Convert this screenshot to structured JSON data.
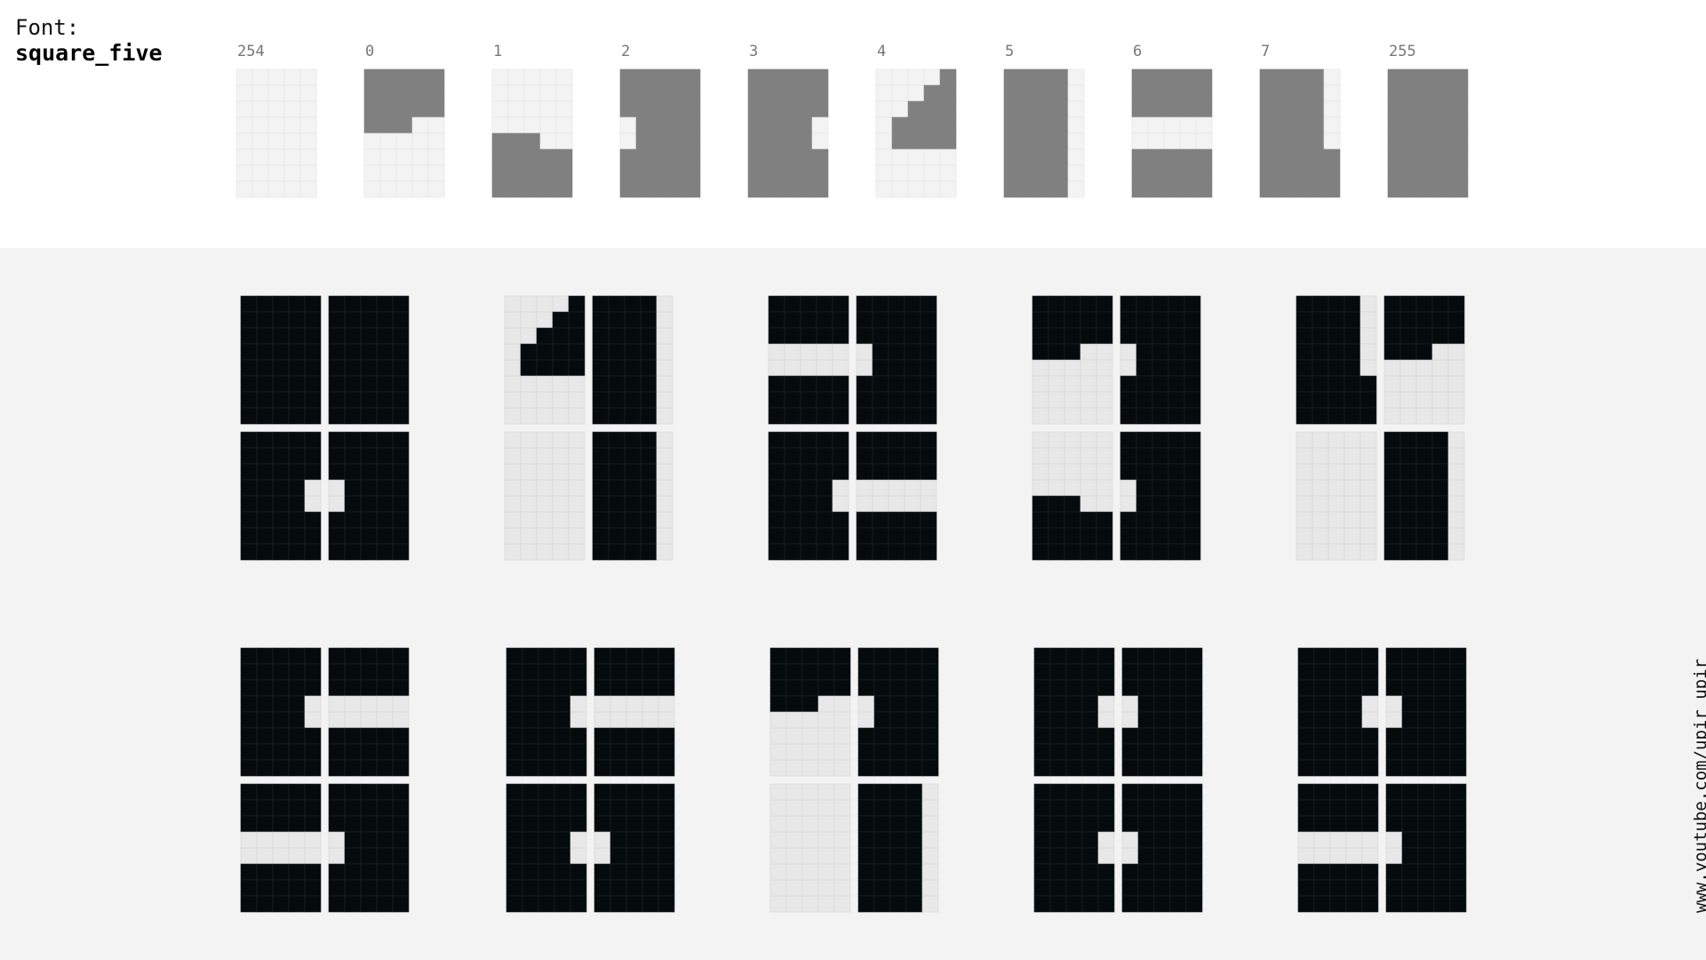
{
  "title": {
    "label": "Font:",
    "font_name": "square_five"
  },
  "footer": {
    "url": "www.youtube.com/upir_upir"
  },
  "colors": {
    "top_filled": "#808080",
    "top_empty": "#f3f3f3",
    "top_grid": "#e2e2e2",
    "bottom_filled": "#050a0c",
    "bottom_empty": "#e8e8e8",
    "bottom_grid": "#1d2628",
    "bottom_empty_grid": "#d4d4d4",
    "bottom_background": "#f3f3f3"
  },
  "glyph_grid": {
    "cols": 5,
    "rows": 8
  },
  "glyphs": [
    {
      "code": "254",
      "pattern": [
        "00000",
        "00000",
        "00000",
        "00000",
        "00000",
        "00000",
        "00000",
        "00000"
      ]
    },
    {
      "code": "0",
      "pattern": [
        "11111",
        "11111",
        "11111",
        "11100",
        "00000",
        "00000",
        "00000",
        "00000"
      ]
    },
    {
      "code": "1",
      "pattern": [
        "00000",
        "00000",
        "00000",
        "00000",
        "11100",
        "11111",
        "11111",
        "11111"
      ]
    },
    {
      "code": "2",
      "pattern": [
        "11111",
        "11111",
        "11111",
        "01111",
        "01111",
        "11111",
        "11111",
        "11111"
      ]
    },
    {
      "code": "3",
      "pattern": [
        "11111",
        "11111",
        "11111",
        "11110",
        "11110",
        "11111",
        "11111",
        "11111"
      ]
    },
    {
      "code": "4",
      "pattern": [
        "00001",
        "00011",
        "00111",
        "01111",
        "01111",
        "00000",
        "00000",
        "00000"
      ]
    },
    {
      "code": "5",
      "pattern": [
        "11110",
        "11110",
        "11110",
        "11110",
        "11110",
        "11110",
        "11110",
        "11110"
      ]
    },
    {
      "code": "6",
      "pattern": [
        "11111",
        "11111",
        "11111",
        "00000",
        "00000",
        "11111",
        "11111",
        "11111"
      ]
    },
    {
      "code": "7",
      "pattern": [
        "11110",
        "11110",
        "11110",
        "11110",
        "11110",
        "11111",
        "11111",
        "11111"
      ]
    },
    {
      "code": "255",
      "pattern": [
        "11111",
        "11111",
        "11111",
        "11111",
        "11111",
        "11111",
        "11111",
        "11111"
      ]
    }
  ],
  "digits": [
    {
      "digit": "8",
      "cells": [
        "255",
        "255",
        "3",
        "2"
      ]
    },
    {
      "digit": "1",
      "cells": [
        "4",
        "5",
        "254",
        "5"
      ]
    },
    {
      "digit": "2",
      "cells": [
        "6",
        "2",
        "3",
        "6"
      ]
    },
    {
      "digit": "3",
      "cells": [
        "0",
        "2",
        "1",
        "2"
      ]
    },
    {
      "digit": "4",
      "cells": [
        "7",
        "0",
        "254",
        "5"
      ]
    },
    {
      "digit": "5",
      "cells": [
        "3",
        "6",
        "6",
        "2"
      ]
    },
    {
      "digit": "6",
      "cells": [
        "3",
        "6",
        "3",
        "2"
      ]
    },
    {
      "digit": "7",
      "cells": [
        "0",
        "2",
        "254",
        "5"
      ]
    },
    {
      "digit": "0",
      "cells": [
        "3",
        "2",
        "3",
        "2"
      ]
    },
    {
      "digit": "9",
      "cells": [
        "3",
        "2",
        "6",
        "2"
      ]
    }
  ]
}
